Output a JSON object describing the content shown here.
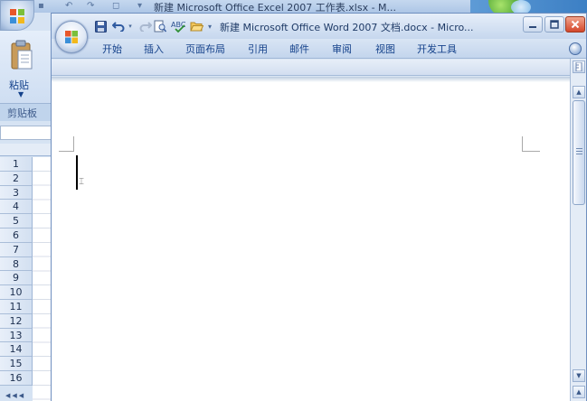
{
  "excel": {
    "title": "新建 Microsoft Office Excel 2007 工作表.xlsx - M...",
    "paste_label": "粘贴",
    "clipboard_group_label": "剪贴板",
    "row_numbers": [
      "1",
      "2",
      "3",
      "4",
      "5",
      "6",
      "7",
      "8",
      "9",
      "10",
      "11",
      "12",
      "13",
      "14",
      "15",
      "16"
    ]
  },
  "word": {
    "title": "新建 Microsoft Office Word 2007 文档.docx - Micro...",
    "tabs": [
      "开始",
      "插入",
      "页面布局",
      "引用",
      "邮件",
      "审阅",
      "视图",
      "开发工具"
    ]
  },
  "icons": {
    "office_button": "office-logo-icon",
    "save": "save-icon",
    "undo": "undo-icon",
    "redo": "redo-icon",
    "print_preview": "print-preview-icon",
    "spelling": "spelling-check-icon",
    "open": "open-folder-icon",
    "qat_dropdown": "qat-dropdown-icon",
    "minimize": "minimize-icon",
    "maximize": "maximize-icon",
    "close": "close-icon",
    "help": "help-icon"
  },
  "colors": {
    "ribbon_text": "#15428b",
    "close_button": "#d3462a",
    "title_text": "#1e3a66"
  }
}
